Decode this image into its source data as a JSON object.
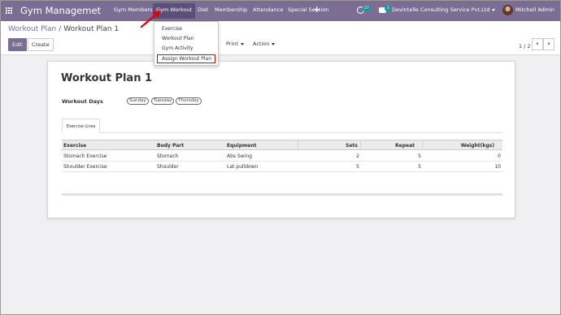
{
  "navbar": {
    "app_title": "Gym Managemet",
    "menu": [
      {
        "label": "Gym Members"
      },
      {
        "label": "Gym Workout"
      },
      {
        "label": "Diet"
      },
      {
        "label": "Membership"
      },
      {
        "label": "Attendance"
      },
      {
        "label": "Special Session"
      }
    ],
    "activity_count": "27",
    "message_count": "3",
    "company": "Devintelle Consulting Service Pvt.Ltd",
    "user": "Mitchell Admin",
    "bg_color": "#7c6d95"
  },
  "breadcrumb": {
    "parent": "Workout Plan",
    "separator": "/",
    "current": "Workout Plan 1"
  },
  "toolbar": {
    "edit_label": "Edit",
    "create_label": "Create",
    "print_label": "Print",
    "action_label": "Action",
    "pager_text": "1 / 2",
    "prev_icon": "chevron-left-icon",
    "next_icon": "chevron-right-icon"
  },
  "dropdown": {
    "items": [
      {
        "label": "Exercise"
      },
      {
        "label": "Workout Plan"
      },
      {
        "label": "Gym Activity"
      },
      {
        "label": "Assign Workout Plan"
      }
    ],
    "highlight_color": "#e10000"
  },
  "form": {
    "title": "Workout Plan 1",
    "workout_days_label": "Workout Days",
    "days": [
      "Sunday",
      "Tuesday",
      "Thursday"
    ],
    "tab_label": "Exercise Lines"
  },
  "table": {
    "headers": {
      "exercise": "Exercise",
      "body_part": "Body Part",
      "equipment": "Equipment",
      "sets": "Sets",
      "repeat": "Repeat",
      "weight": "Weight(kgs)"
    },
    "rows": [
      {
        "exercise": "Stomach Exercise",
        "body_part": "Stomach",
        "equipment": "Abs Swing",
        "sets": "2",
        "repeat": "5",
        "weight": "0"
      },
      {
        "exercise": "Shoulder Exercise",
        "body_part": "Shoulder",
        "equipment": "Lat pulldown",
        "sets": "5",
        "repeat": "5",
        "weight": "10"
      }
    ]
  }
}
